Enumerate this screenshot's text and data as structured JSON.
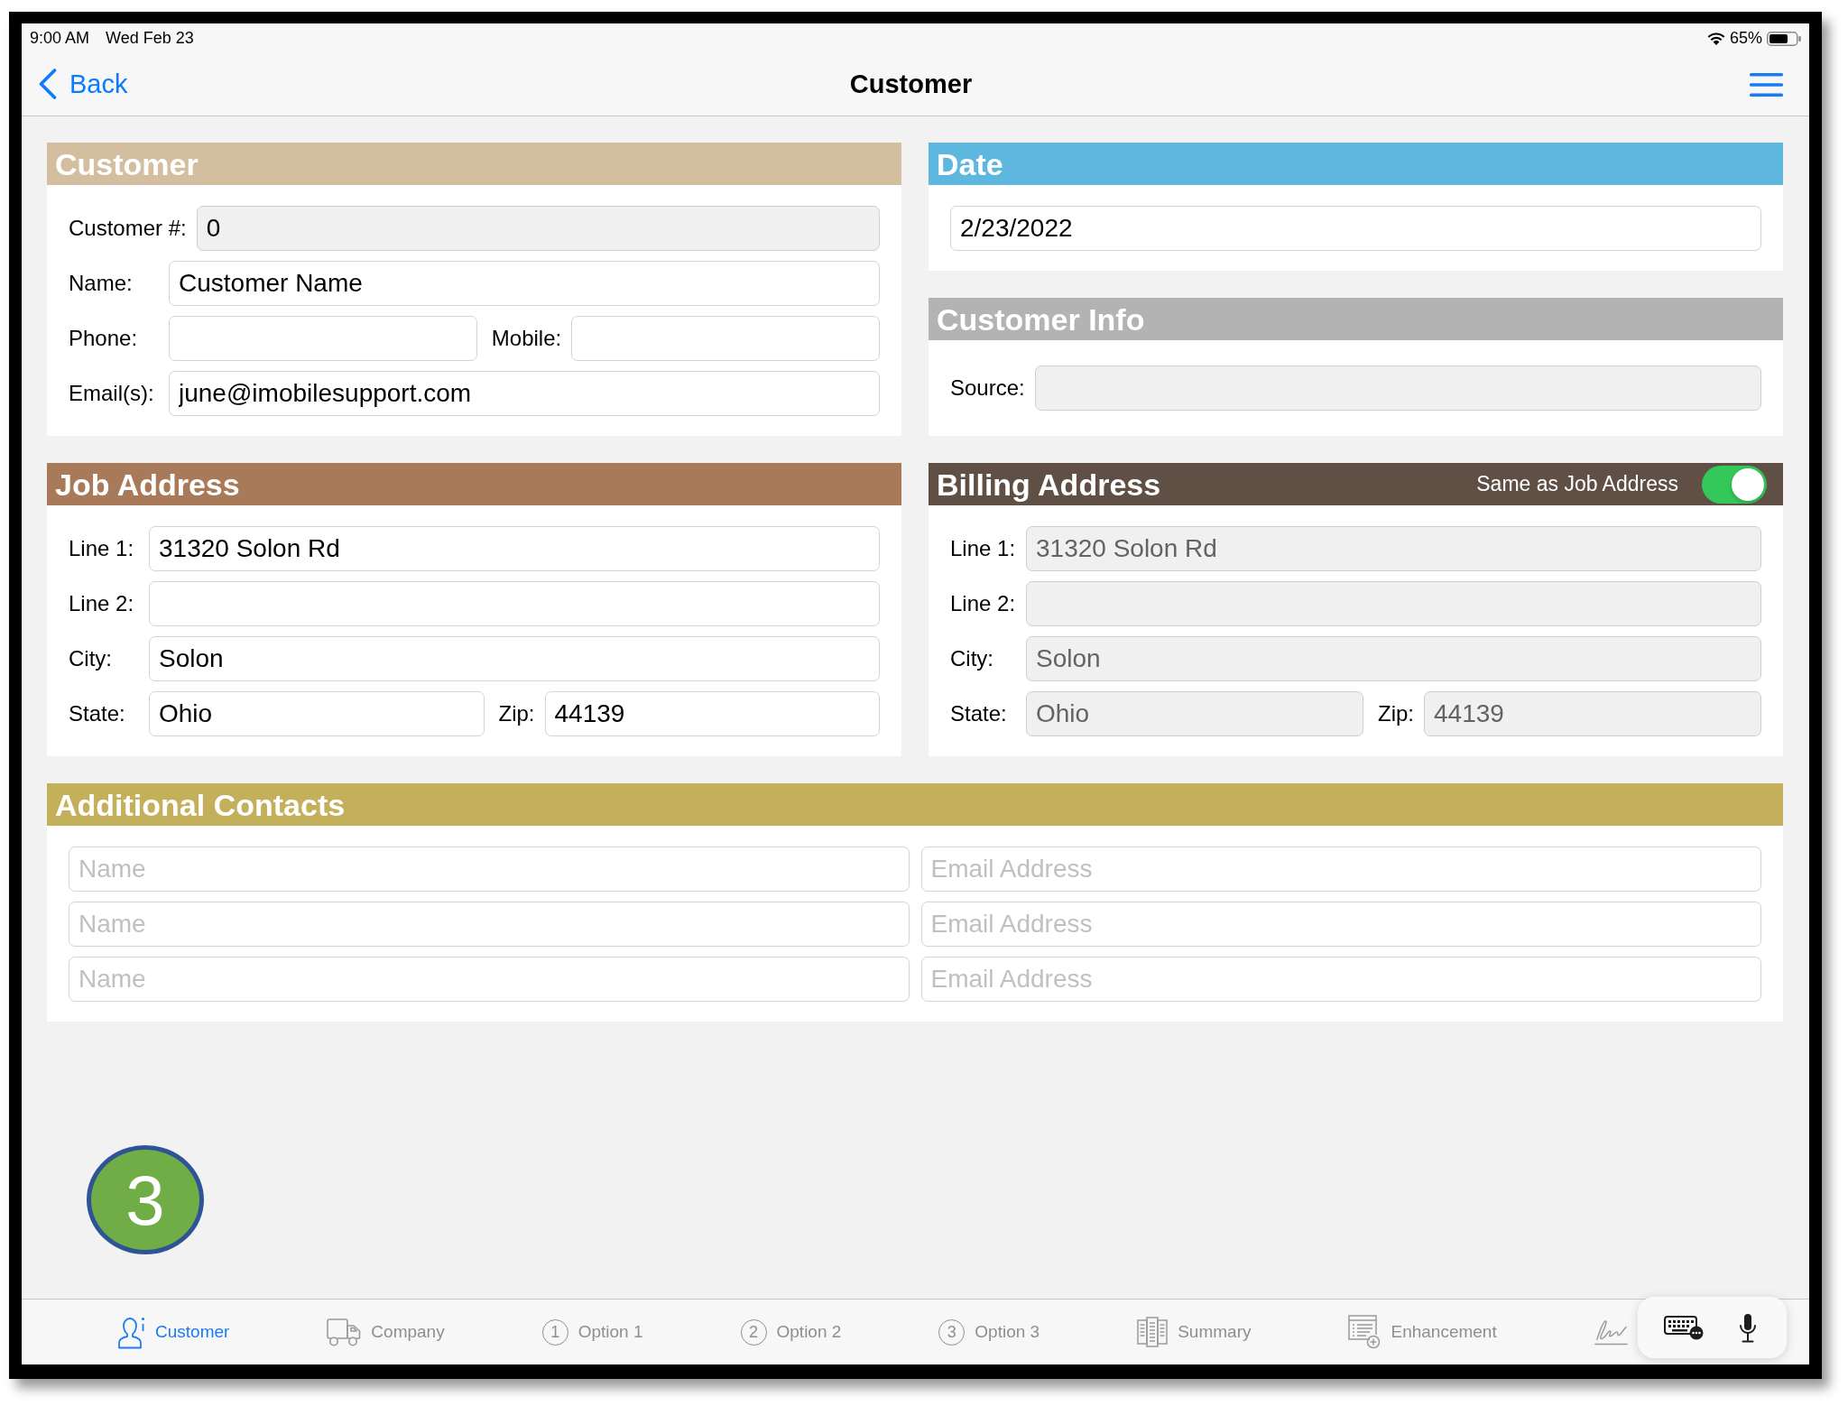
{
  "status_bar": {
    "time": "9:00 AM",
    "date": "Wed Feb 23",
    "battery": "65%"
  },
  "nav_bar": {
    "back": "Back",
    "title": "Customer"
  },
  "customer": {
    "title": "Customer",
    "rows": [
      {
        "fields": [
          {
            "label": "Customer #:",
            "value": "0",
            "readonly": true
          }
        ]
      },
      {
        "fields": [
          {
            "label": "Name:",
            "value": "Customer Name",
            "readonly": false
          }
        ]
      },
      {
        "fields": [
          {
            "label": "Phone:",
            "readonly": false
          },
          {
            "label": "Mobile:",
            "readonly": false
          }
        ]
      },
      {
        "fields": [
          {
            "label": "Email(s):",
            "value": "june@imobilesupport.com",
            "readonly": false
          }
        ]
      }
    ]
  },
  "date": {
    "title": "Date",
    "value": "2/23/2022"
  },
  "customer_info": {
    "title": "Customer Info",
    "rows": [
      {
        "fields": [
          {
            "label": "Source:",
            "readonly": true
          }
        ]
      }
    ]
  },
  "job_address": {
    "title": "Job Address",
    "rows": [
      {
        "fields": [
          {
            "label": "Line 1:",
            "value": "31320 Solon Rd"
          }
        ]
      },
      {
        "fields": [
          {
            "label": "Line 2:"
          }
        ]
      },
      {
        "fields": [
          {
            "label": "City:",
            "value": "Solon"
          }
        ]
      },
      {
        "fields": [
          {
            "label": "State:",
            "value": "Ohio"
          },
          {
            "label": "Zip:",
            "value": "44139"
          }
        ]
      }
    ]
  },
  "billing_address": {
    "title": "Billing Address",
    "same_as_job": {
      "label": "Same as Job Address",
      "on": true
    },
    "rows": [
      {
        "fields": [
          {
            "label": "Line 1:",
            "value": "31320 Solon Rd",
            "disabled": true
          }
        ]
      },
      {
        "fields": [
          {
            "label": "Line 2:",
            "disabled": true
          }
        ]
      },
      {
        "fields": [
          {
            "label": "City:",
            "value": "Solon",
            "disabled": true
          }
        ]
      },
      {
        "fields": [
          {
            "label": "State:",
            "value": "Ohio",
            "disabled": true
          },
          {
            "label": "Zip:",
            "value": "44139",
            "disabled": true
          }
        ]
      }
    ]
  },
  "additional_contacts": {
    "title": "Additional Contacts",
    "contacts": [
      {
        "name": {
          "placeholder": "Name"
        },
        "email": {
          "placeholder": "Email Address"
        }
      },
      {
        "name": {
          "placeholder": "Name"
        },
        "email": {
          "placeholder": "Email Address"
        }
      },
      {
        "name": {
          "placeholder": "Name"
        },
        "email": {
          "placeholder": "Email Address"
        }
      }
    ]
  },
  "step_marker": "3",
  "tab_bar": {
    "items": [
      {
        "label": "Customer",
        "selected": true
      },
      {
        "label": "Company",
        "selected": false
      },
      {
        "label": "Option 1",
        "number": "1",
        "selected": false
      },
      {
        "label": "Option 2",
        "number": "2",
        "selected": false
      },
      {
        "label": "Option 3",
        "number": "3",
        "selected": false
      },
      {
        "label": "Summary",
        "selected": false
      },
      {
        "label": "Enhancement",
        "selected": false
      },
      {
        "selected": false
      }
    ]
  }
}
